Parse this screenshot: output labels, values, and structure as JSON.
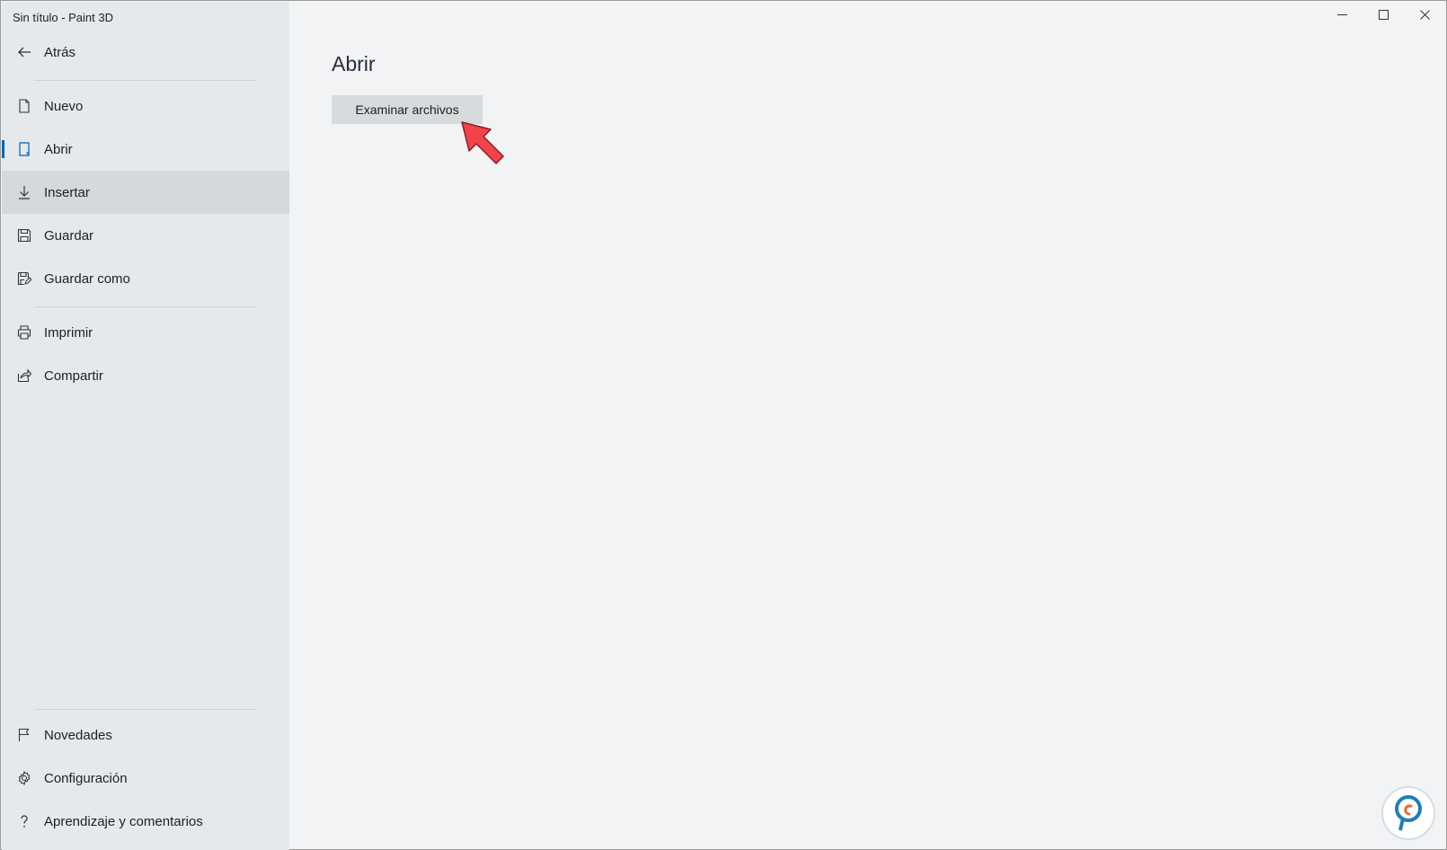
{
  "window": {
    "title": "Sin título - Paint 3D",
    "controls": {
      "minimize_icon": "minimize-icon",
      "maximize_icon": "maximize-icon",
      "close_icon": "close-icon"
    }
  },
  "sidebar": {
    "back": {
      "label": "Atrás",
      "icon": "arrow-left-icon"
    },
    "items": [
      {
        "label": "Nuevo",
        "icon": "new-document-icon"
      },
      {
        "label": "Abrir",
        "icon": "open-document-icon",
        "selected": true
      },
      {
        "label": "Insertar",
        "icon": "insert-download-icon",
        "hovered": true
      },
      {
        "label": "Guardar",
        "icon": "save-icon"
      },
      {
        "label": "Guardar como",
        "icon": "save-as-icon"
      },
      {
        "label": "Imprimir",
        "icon": "print-icon"
      },
      {
        "label": "Compartir",
        "icon": "share-icon"
      }
    ],
    "footer": [
      {
        "label": "Novedades",
        "icon": "flag-icon"
      },
      {
        "label": "Configuración",
        "icon": "gear-icon"
      },
      {
        "label": "Aprendizaje y comentarios",
        "icon": "question-icon"
      }
    ]
  },
  "main": {
    "heading": "Abrir",
    "browse_button": "Examinar archivos"
  },
  "colors": {
    "sidebar_bg": "#e6e9ec",
    "main_bg": "#f1f3f5",
    "accent": "#0063b1",
    "hover_bg": "#d5d9de",
    "button_bg": "#d8dbde",
    "annotation_arrow": "#f2424a"
  }
}
